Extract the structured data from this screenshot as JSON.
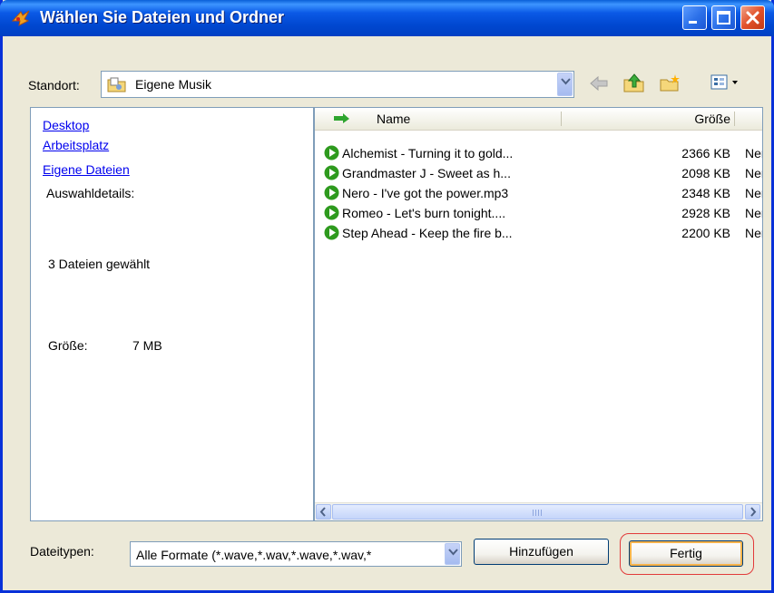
{
  "window": {
    "title": "Wählen Sie Dateien und Ordner"
  },
  "toolbar": {
    "location_label": "Standort:",
    "location_value": "Eigene Musik",
    "icons": [
      "back-arrow-icon",
      "up-folder-icon",
      "new-folder-icon",
      "view-menu-icon"
    ]
  },
  "sidebar": {
    "links": [
      "Desktop",
      "Arbeitsplatz",
      "Eigene Dateien"
    ],
    "details_label": "Auswahldetails:",
    "selected_count": "3 Dateien gewählt",
    "size_label": "Größe:",
    "size_value": "7 MB"
  },
  "file_list": {
    "columns": [
      "Name",
      "Größe"
    ],
    "rows": [
      {
        "name": "Alchemist - Turning it to gold...",
        "size": "2366 KB",
        "type": "Ner"
      },
      {
        "name": "Grandmaster J - Sweet as h...",
        "size": "2098 KB",
        "type": "Ner"
      },
      {
        "name": "Nero -  I've got the power.mp3",
        "size": "2348 KB",
        "type": "Ner"
      },
      {
        "name": "Romeo -  Let's burn tonight....",
        "size": "2928 KB",
        "type": "Ner"
      },
      {
        "name": "Step Ahead - Keep the fire b...",
        "size": "2200 KB",
        "type": "Ner"
      }
    ]
  },
  "footer": {
    "filetypes_label": "Dateitypen:",
    "filetypes_value": "Alle Formate  (*.wave,*.wav,*.wave,*.wav,*",
    "add_button": "Hinzufügen",
    "done_button": "Fertig"
  },
  "colors": {
    "titlebar": "#0047d0",
    "link": "#0000ee",
    "play_icon": "#2e9a1e",
    "highlight": "#e23a3a"
  }
}
